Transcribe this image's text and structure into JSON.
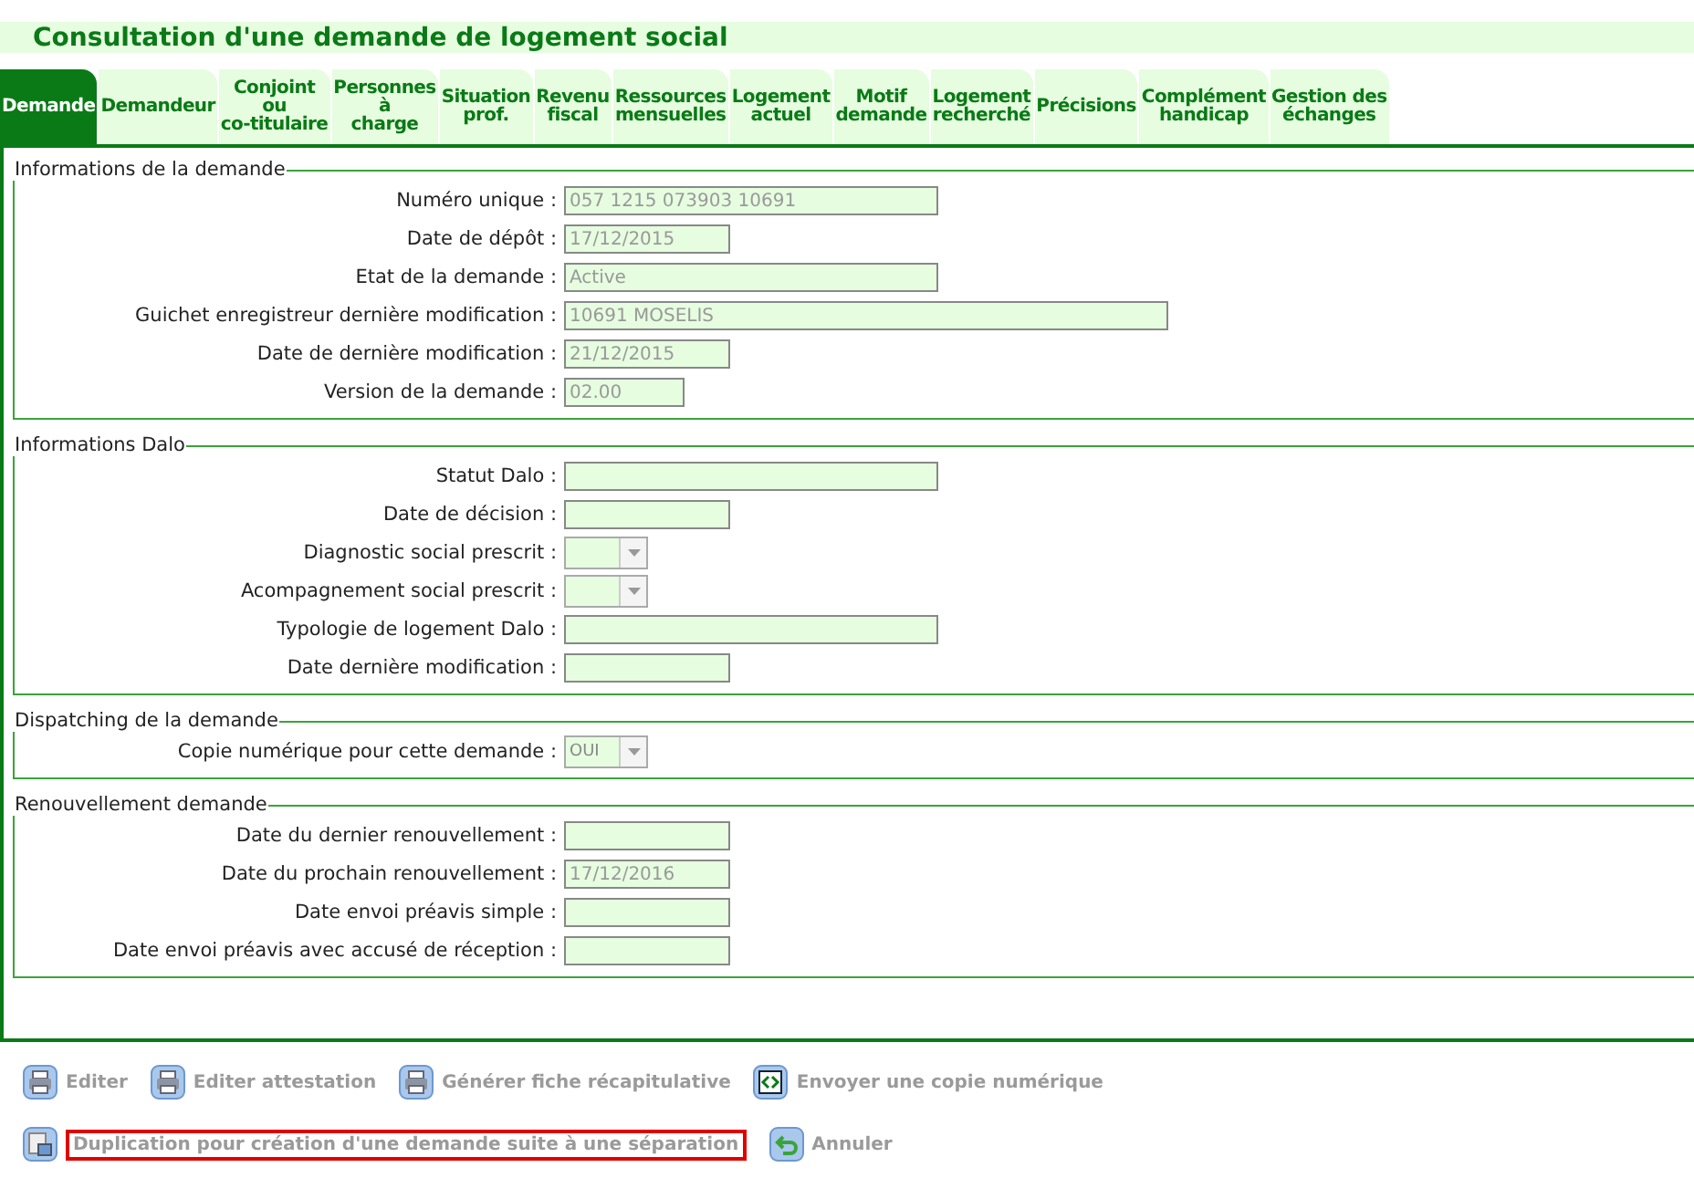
{
  "title": "Consultation d'une demande de logement social",
  "tabs": [
    {
      "label": "Demande",
      "selected": true
    },
    {
      "label": "Demandeur",
      "selected": false
    },
    {
      "label": "Conjoint\nou\nco-titulaire",
      "selected": false
    },
    {
      "label": "Personnes\nà\ncharge",
      "selected": false
    },
    {
      "label": "Situation\nprof.",
      "selected": false
    },
    {
      "label": "Revenu\nfiscal",
      "selected": false
    },
    {
      "label": "Ressources\nmensuelles",
      "selected": false
    },
    {
      "label": "Logement\nactuel",
      "selected": false
    },
    {
      "label": "Motif\ndemande",
      "selected": false
    },
    {
      "label": "Logement\nrecherché",
      "selected": false
    },
    {
      "label": "Précisions",
      "selected": false
    },
    {
      "label": "Complément\nhandicap",
      "selected": false
    },
    {
      "label": "Gestion des\néchanges",
      "selected": false
    }
  ],
  "sections": [
    {
      "legend": "Informations de la demande",
      "fields": [
        {
          "label": "Numéro unique :",
          "kind": "long",
          "value": "057 1215 073903 10691"
        },
        {
          "label": "Date de dépôt :",
          "kind": "short",
          "value": "17/12/2015"
        },
        {
          "label": "Etat de la demande :",
          "kind": "long",
          "value": "Active"
        },
        {
          "label": "Guichet enregistreur dernière modification :",
          "kind": "wide",
          "value": "10691 MOSELIS"
        },
        {
          "label": "Date de dernière modification :",
          "kind": "short",
          "value": "21/12/2015"
        },
        {
          "label": "Version de la demande :",
          "kind": "tiny",
          "value": "02.00"
        }
      ]
    },
    {
      "legend": "Informations Dalo",
      "fields": [
        {
          "label": "Statut Dalo :",
          "kind": "long"
        },
        {
          "label": "Date de décision :",
          "kind": "short"
        },
        {
          "label": "Diagnostic social prescrit :",
          "kind": "select"
        },
        {
          "label": "Acompagnement social prescrit :",
          "kind": "select"
        },
        {
          "label": "Typologie de logement Dalo :",
          "kind": "long"
        },
        {
          "label": "Date dernière modification :",
          "kind": "short"
        }
      ]
    },
    {
      "legend": "Dispatching de la demande",
      "fields": [
        {
          "label": "Copie numérique pour cette demande :",
          "kind": "select",
          "value": "OUI"
        }
      ]
    },
    {
      "legend": "Renouvellement demande",
      "fields": [
        {
          "label": "Date du dernier renouvellement :",
          "kind": "short"
        },
        {
          "label": "Date du prochain renouvellement :",
          "kind": "short",
          "value": "17/12/2016"
        },
        {
          "label": "Date envoi préavis simple :",
          "kind": "short"
        },
        {
          "label": "Date envoi préavis avec accusé de réception :",
          "kind": "short"
        }
      ]
    }
  ],
  "actions": [
    [
      {
        "label": "Editer",
        "kind": "print",
        "disabled": true,
        "highlighted": false
      },
      {
        "label": "Editer attestation",
        "kind": "print",
        "disabled": true,
        "highlighted": false
      },
      {
        "label": "Générer fiche récapitulative",
        "kind": "print",
        "disabled": true,
        "highlighted": false
      },
      {
        "label": "Envoyer une copie numérique",
        "kind": "send",
        "disabled": true,
        "highlighted": false
      }
    ],
    [
      {
        "label": "Duplication pour création d'une demande suite à une séparation",
        "kind": "duplicate",
        "disabled": true,
        "highlighted": true
      },
      {
        "label": "Annuler",
        "kind": "cancel",
        "disabled": true,
        "highlighted": false
      }
    ]
  ]
}
